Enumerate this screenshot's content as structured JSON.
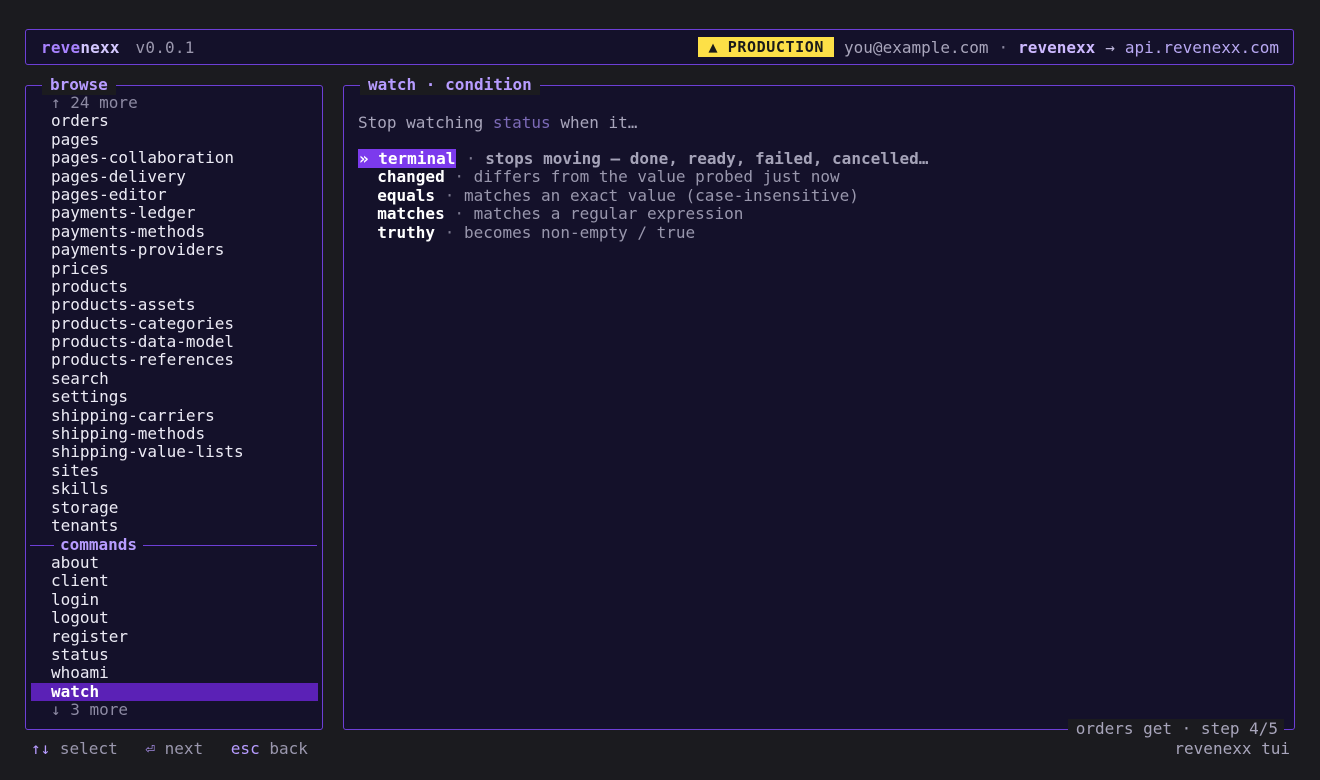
{
  "header": {
    "brand_part1": "reve",
    "brand_part2": "nexx",
    "version": "v0.0.1",
    "env_badge": "▲ PRODUCTION",
    "user": "you@example.com",
    "separator": "·",
    "app": "revenexx",
    "arrow": "→",
    "api": "api.revenexx.com"
  },
  "browse": {
    "title": "browse",
    "more_above": "↑ 24 more",
    "items": [
      "orders",
      "pages",
      "pages-collaboration",
      "pages-delivery",
      "pages-editor",
      "payments-ledger",
      "payments-methods",
      "payments-providers",
      "prices",
      "products",
      "products-assets",
      "products-categories",
      "products-data-model",
      "products-references",
      "search",
      "settings",
      "shipping-carriers",
      "shipping-methods",
      "shipping-value-lists",
      "sites",
      "skills",
      "storage",
      "tenants"
    ]
  },
  "commands": {
    "title": "commands",
    "items": [
      "about",
      "client",
      "login",
      "logout",
      "register",
      "status",
      "whoami",
      "watch"
    ],
    "selected": "watch",
    "more_below": "↓ 3 more"
  },
  "main": {
    "title": "watch · condition",
    "prompt_before": "Stop watching",
    "prompt_field": "status",
    "prompt_after": "when it…",
    "active_marker": "»",
    "options": [
      {
        "name": "terminal",
        "desc": "stops moving — done, ready, failed, cancelled…"
      },
      {
        "name": "changed",
        "desc": "differs from the value probed just now"
      },
      {
        "name": "equals",
        "desc": "matches an exact value (case-insensitive)"
      },
      {
        "name": "matches",
        "desc": "matches a regular expression"
      },
      {
        "name": "truthy",
        "desc": "becomes non-empty / true"
      }
    ],
    "option_sep": "·",
    "step_label": "orders get · step 4/5"
  },
  "footer": {
    "select_key": "↑↓",
    "select_label": "select",
    "next_key": "⏎",
    "next_label": "next",
    "back_key": "esc",
    "back_label": "back",
    "app_label": "revenexx tui"
  },
  "colors": {
    "accent": "#6d3fd6",
    "selection": "#5b21b6",
    "badge": "#fde047",
    "panel_bg": "#14112a",
    "page_bg": "#1b1b1f"
  }
}
